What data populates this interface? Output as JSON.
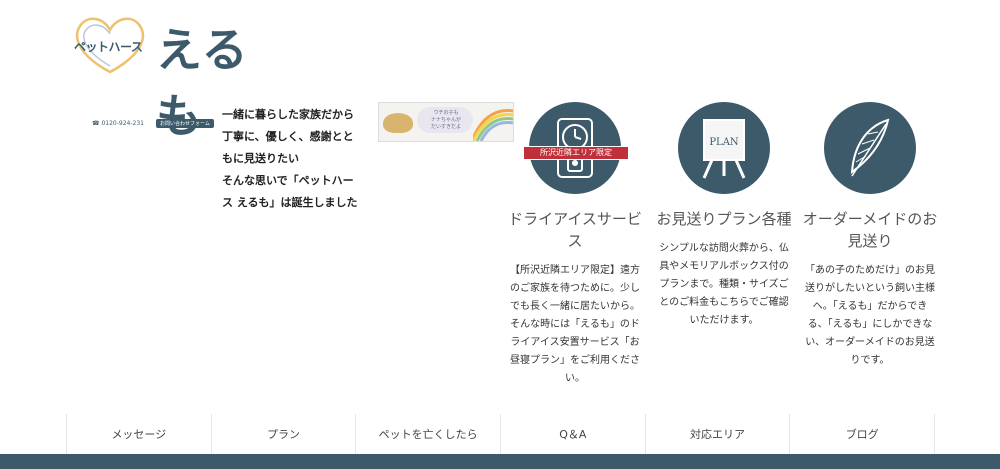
{
  "logo": {
    "sub": "ペットハース",
    "main": "えるも"
  },
  "contact": {
    "tel": "0120-924-231",
    "form_label": "お問い合わせフォーム"
  },
  "intro": {
    "lines": [
      "一緒に暮らした家族だから",
      "丁寧に、優しく、感謝とともに見送りたい",
      "そんな思いで「ペットハース えるも」は誕生しました"
    ]
  },
  "banner": {
    "text": "ウチの子も\nナナちゃんが\nだいすきだよ"
  },
  "cards": [
    {
      "icon": "clock-icon",
      "ribbon": "所沢近隣エリア限定",
      "title": "ドライアイスサービス",
      "desc": "【所沢近隣エリア限定】遠方のご家族を待つために。少しでも長く一緒に居たいから。そんな時には「えるも」のドライアイス安置サービス「お昼寝プラン」をご利用ください。"
    },
    {
      "icon": "plan-easel-icon",
      "plan_text": "PLAN",
      "title": "お見送りプラン各種",
      "desc": "シンプルな訪問火葬から、仏具やメモリアルボックス付のプランまで。種類・サイズごとのご料金もこちらでご確認いただけます。"
    },
    {
      "icon": "feather-icon",
      "title": "オーダーメイドのお見送り",
      "desc": "「あの子のためだけ」のお見送りがしたいという飼い主様へ。「えるも」だからできる、「えるも」にしかできない、オーダーメイドのお見送りです。"
    }
  ],
  "nav": [
    "メッセージ",
    "プラン",
    "ペットを亡くしたら",
    "Q＆A",
    "対応エリア",
    "ブログ"
  ],
  "colors": {
    "brand": "#3d5a6b",
    "ribbon": "#c0303a"
  }
}
